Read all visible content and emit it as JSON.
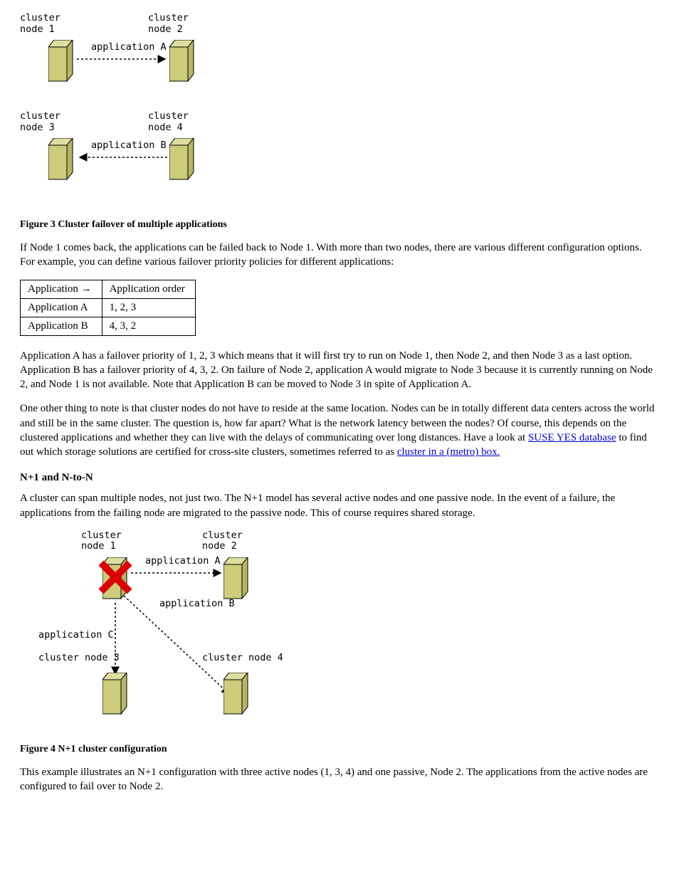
{
  "diagram1": {
    "node1": "cluster\nnode 1",
    "node2": "cluster\nnode 2",
    "node3": "cluster\nnode 3",
    "node4": "cluster\nnode 4",
    "appA": "application A",
    "appB": "application B"
  },
  "fig3_caption": "Figure 3 Cluster failover of multiple applications",
  "para_priority_intro": "If Node 1 comes back, the applications can be failed back to Node 1. With more than two nodes, there are various different configuration options. For example, you can define various failover priority policies for different applications:",
  "table": {
    "col1": "Application →",
    "col2": "Application order",
    "rowA_c1": "Application A",
    "rowA_c2": "1, 2, 3",
    "rowB_c1": "Application B",
    "rowB_c2": "4, 3, 2"
  },
  "para_failover1": "Application A has a failover priority of 1, 2, 3 which means that it will first try to run on Node 1, then Node 2, and then Node 3 as a last option. Application B has a failover priority of 4, 3, 2. On failure of Node 2, application A would migrate to Node 3 because it is currently running on Node 2, and Node 1 is not available. Note that Application B can be moved to Node 3 in spite of Application A.",
  "para_failover2_a": "One other thing to note is that cluster nodes do not have to reside at the same location. Nodes can be in totally different data centers across the world and still be in the same cluster. The question is, how far apart? What is the network latency between the nodes? Of course, this depends on the clustered applications and whether they can live with the delays of communicating over long distances. Have a look at ",
  "para_failover2_link1": "SUSE YES database",
  "para_failover2_b": " to find out which storage solutions are certified for cross-site clusters, sometimes referred to as ",
  "para_failover2_link2": "cluster in a (metro) box.",
  "section_nplus1": "N+1 and N-to-N",
  "para_nplus1": "A cluster can span multiple nodes, not just two. The N+1 model has several active nodes and one passive node. In the event of a failure, the applications from the failing node are migrated to the passive node. This of course requires shared storage.",
  "diagram2": {
    "node1": "cluster\nnode 1",
    "node2": "cluster\nnode 2",
    "node3": "cluster node 3",
    "node4": "cluster node 4",
    "appA": "application A",
    "appB": "application B",
    "appC": "application C"
  },
  "fig4_caption": "Figure 4 N+1 cluster configuration",
  "para_end": "This example illustrates an N+1 configuration with three active nodes (1, 3, 4) and one passive, Node 2. The applications from the active nodes are configured to fail over to Node 2."
}
